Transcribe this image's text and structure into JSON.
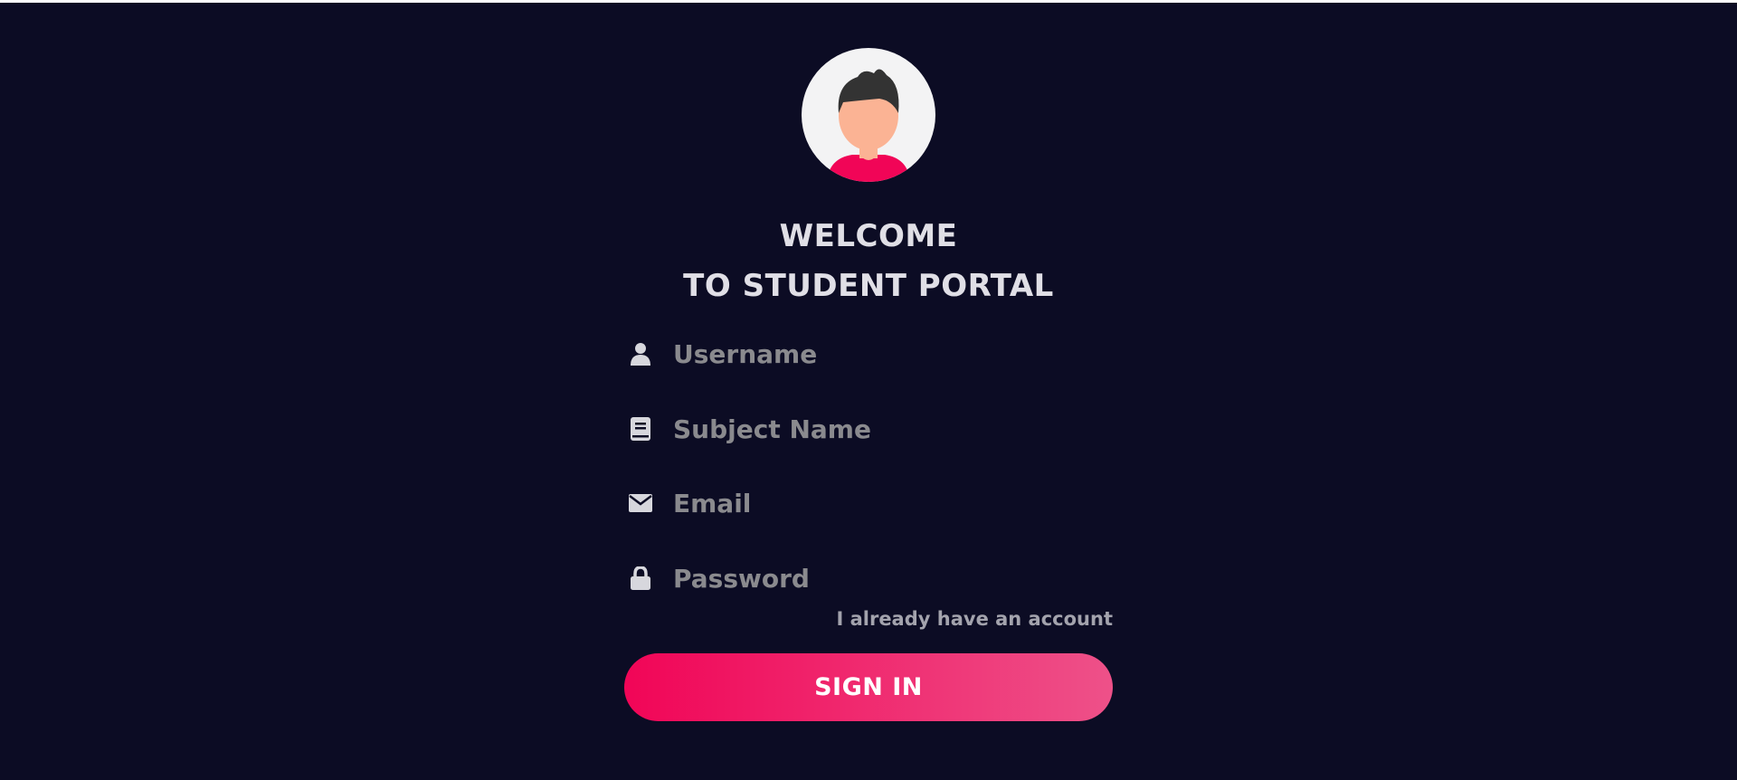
{
  "header": {
    "avatar_icon": "student-avatar",
    "title_line1": "WELCOME",
    "title_line2": "TO STUDENT PORTAL"
  },
  "form": {
    "fields": [
      {
        "icon": "user-icon",
        "placeholder": "Username",
        "value": ""
      },
      {
        "icon": "book-icon",
        "placeholder": "Subject Name",
        "value": ""
      },
      {
        "icon": "envelope-icon",
        "placeholder": "Email",
        "value": ""
      },
      {
        "icon": "lock-icon",
        "placeholder": "Password",
        "value": ""
      }
    ],
    "account_link": "I already have an account",
    "submit_label": "SIGN IN"
  },
  "colors": {
    "background": "#0c0c24",
    "title_text": "#e0dfe6",
    "placeholder_text": "#8a8a8e",
    "link_text": "#a3a3ad",
    "button_gradient_start": "#f10557",
    "button_gradient_end": "#ee5189",
    "avatar_bg": "#f3f3f4",
    "avatar_shirt": "#f10557",
    "avatar_skin": "#fbb394",
    "avatar_hair": "#333333"
  }
}
